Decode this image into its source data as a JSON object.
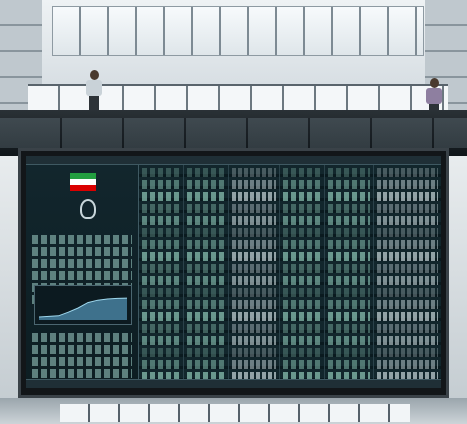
{
  "scene": {
    "description_colors": {
      "board_background": "#0a1a1f",
      "flag_green": "#239f40",
      "flag_red": "#da0000",
      "chart_fill": "#4f8fb0"
    }
  },
  "board": {
    "header_left": "",
    "header_right": "",
    "index_chart": {
      "values": [
        0.1,
        0.12,
        0.14,
        0.26,
        0.4,
        0.58,
        0.66,
        0.7,
        0.72,
        0.73
      ]
    },
    "column_count": 6
  }
}
